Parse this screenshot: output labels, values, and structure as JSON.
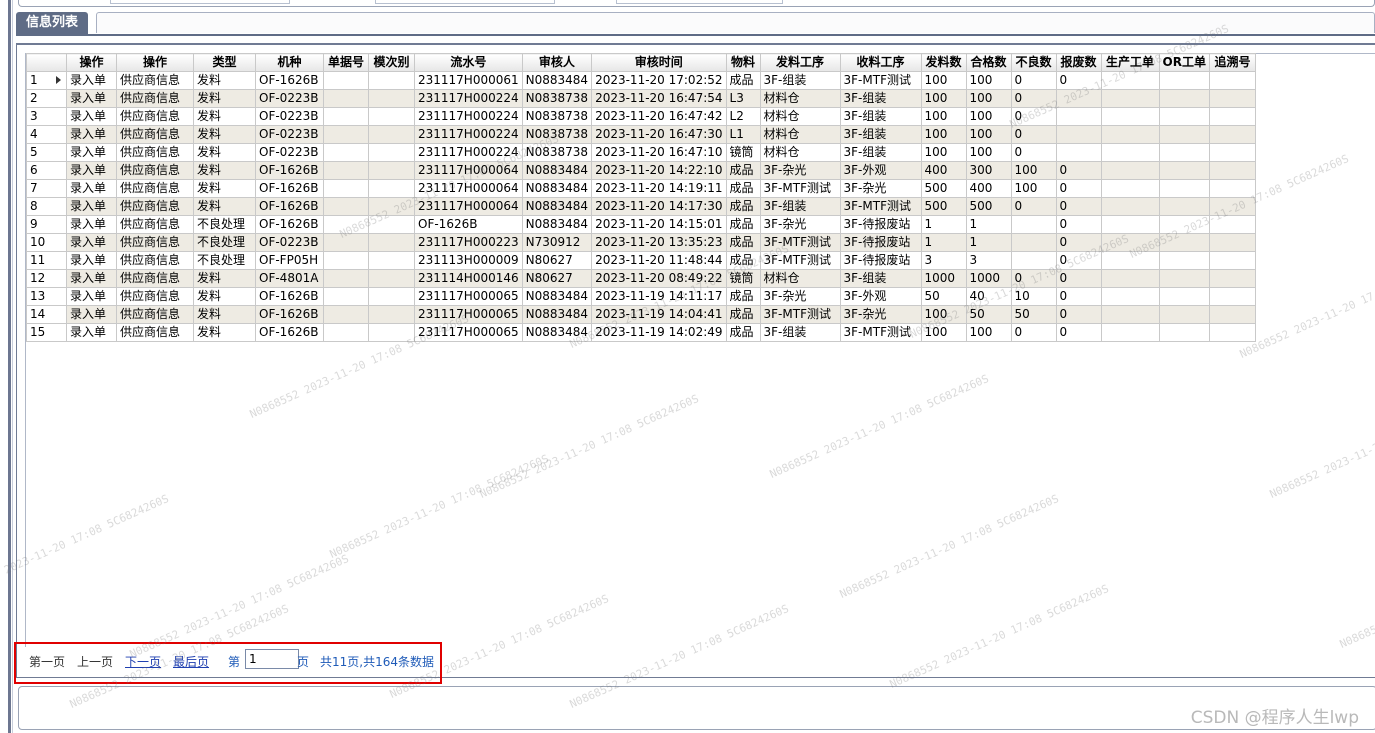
{
  "tab": {
    "label": "信息列表"
  },
  "table": {
    "headers": [
      "操作",
      "操作",
      "类型",
      "机种",
      "单据号",
      "模次别",
      "流水号",
      "审核人",
      "审核时间",
      "物料",
      "发料工序",
      "收料工序",
      "发料数",
      "合格数",
      "不良数",
      "报废数",
      "生产工单",
      "OR工单",
      "追溯号"
    ],
    "rows": [
      [
        "1",
        "录入单",
        "供应商信息",
        "发料",
        "OF-1626B",
        "",
        "",
        "231117H000061",
        "N0883484",
        "2023-11-20 17:02:52",
        "成品",
        "3F-组装",
        "3F-MTF测试",
        "100",
        "100",
        "0",
        "0",
        "",
        "",
        ""
      ],
      [
        "2",
        "录入单",
        "供应商信息",
        "发料",
        "OF-0223B",
        "",
        "",
        "231117H000224",
        "N0838738",
        "2023-11-20 16:47:54",
        "L3",
        "材料仓",
        "3F-组装",
        "100",
        "100",
        "0",
        "",
        "",
        "",
        ""
      ],
      [
        "3",
        "录入单",
        "供应商信息",
        "发料",
        "OF-0223B",
        "",
        "",
        "231117H000224",
        "N0838738",
        "2023-11-20 16:47:42",
        "L2",
        "材料仓",
        "3F-组装",
        "100",
        "100",
        "0",
        "",
        "",
        "",
        ""
      ],
      [
        "4",
        "录入单",
        "供应商信息",
        "发料",
        "OF-0223B",
        "",
        "",
        "231117H000224",
        "N0838738",
        "2023-11-20 16:47:30",
        "L1",
        "材料仓",
        "3F-组装",
        "100",
        "100",
        "0",
        "",
        "",
        "",
        ""
      ],
      [
        "5",
        "录入单",
        "供应商信息",
        "发料",
        "OF-0223B",
        "",
        "",
        "231117H000224",
        "N0838738",
        "2023-11-20 16:47:10",
        "镜筒",
        "材料仓",
        "3F-组装",
        "100",
        "100",
        "0",
        "",
        "",
        "",
        ""
      ],
      [
        "6",
        "录入单",
        "供应商信息",
        "发料",
        "OF-1626B",
        "",
        "",
        "231117H000064",
        "N0883484",
        "2023-11-20 14:22:10",
        "成品",
        "3F-杂光",
        "3F-外观",
        "400",
        "300",
        "100",
        "0",
        "",
        "",
        ""
      ],
      [
        "7",
        "录入单",
        "供应商信息",
        "发料",
        "OF-1626B",
        "",
        "",
        "231117H000064",
        "N0883484",
        "2023-11-20 14:19:11",
        "成品",
        "3F-MTF测试",
        "3F-杂光",
        "500",
        "400",
        "100",
        "0",
        "",
        "",
        ""
      ],
      [
        "8",
        "录入单",
        "供应商信息",
        "发料",
        "OF-1626B",
        "",
        "",
        "231117H000064",
        "N0883484",
        "2023-11-20 14:17:30",
        "成品",
        "3F-组装",
        "3F-MTF测试",
        "500",
        "500",
        "0",
        "0",
        "",
        "",
        ""
      ],
      [
        "9",
        "录入单",
        "供应商信息",
        "不良处理",
        "OF-1626B",
        "",
        "",
        "OF-1626B",
        "N0883484",
        "2023-11-20 14:15:01",
        "成品",
        "3F-杂光",
        "3F-待报废站",
        "1",
        "1",
        "",
        "0",
        "",
        "",
        ""
      ],
      [
        "10",
        "录入单",
        "供应商信息",
        "不良处理",
        "OF-0223B",
        "",
        "",
        "231117H000223",
        "N730912",
        "2023-11-20 13:35:23",
        "成品",
        "3F-MTF测试",
        "3F-待报废站",
        "1",
        "1",
        "",
        "0",
        "",
        "",
        ""
      ],
      [
        "11",
        "录入单",
        "供应商信息",
        "不良处理",
        "OF-FP05H",
        "",
        "",
        "231113H000009",
        "N80627",
        "2023-11-20 11:48:44",
        "成品",
        "3F-MTF测试",
        "3F-待报废站",
        "3",
        "3",
        "",
        "0",
        "",
        "",
        ""
      ],
      [
        "12",
        "录入单",
        "供应商信息",
        "发料",
        "OF-4801A",
        "",
        "",
        "231114H000146",
        "N80627",
        "2023-11-20 08:49:22",
        "镜筒",
        "材料仓",
        "3F-组装",
        "1000",
        "1000",
        "0",
        "0",
        "",
        "",
        ""
      ],
      [
        "13",
        "录入单",
        "供应商信息",
        "发料",
        "OF-1626B",
        "",
        "",
        "231117H000065",
        "N0883484",
        "2023-11-19 14:11:17",
        "成品",
        "3F-杂光",
        "3F-外观",
        "50",
        "40",
        "10",
        "0",
        "",
        "",
        ""
      ],
      [
        "14",
        "录入单",
        "供应商信息",
        "发料",
        "OF-1626B",
        "",
        "",
        "231117H000065",
        "N0883484",
        "2023-11-19 14:04:41",
        "成品",
        "3F-MTF测试",
        "3F-杂光",
        "100",
        "50",
        "50",
        "0",
        "",
        "",
        ""
      ],
      [
        "15",
        "录入单",
        "供应商信息",
        "发料",
        "OF-1626B",
        "",
        "",
        "231117H000065",
        "N0883484",
        "2023-11-19 14:02:49",
        "成品",
        "3F-组装",
        "3F-MTF测试",
        "100",
        "100",
        "0",
        "0",
        "",
        "",
        ""
      ]
    ]
  },
  "pager": {
    "first": "第一页",
    "prev": "上一页",
    "next": "下一页",
    "last": "最后页",
    "page_prefix": "第",
    "page_value": "1",
    "page_suffix": "页",
    "summary": "共11页,共164条数据"
  },
  "watermark": "N0868552 2023-11-20 17:08 5C6824260S",
  "footer_brand": "CSDN @程序人生lwp",
  "colors": {
    "header_tab": "#5f6c86",
    "row_alt": "#eeebe3",
    "highlight_border": "#e00000",
    "link": "#1f3fb0"
  }
}
